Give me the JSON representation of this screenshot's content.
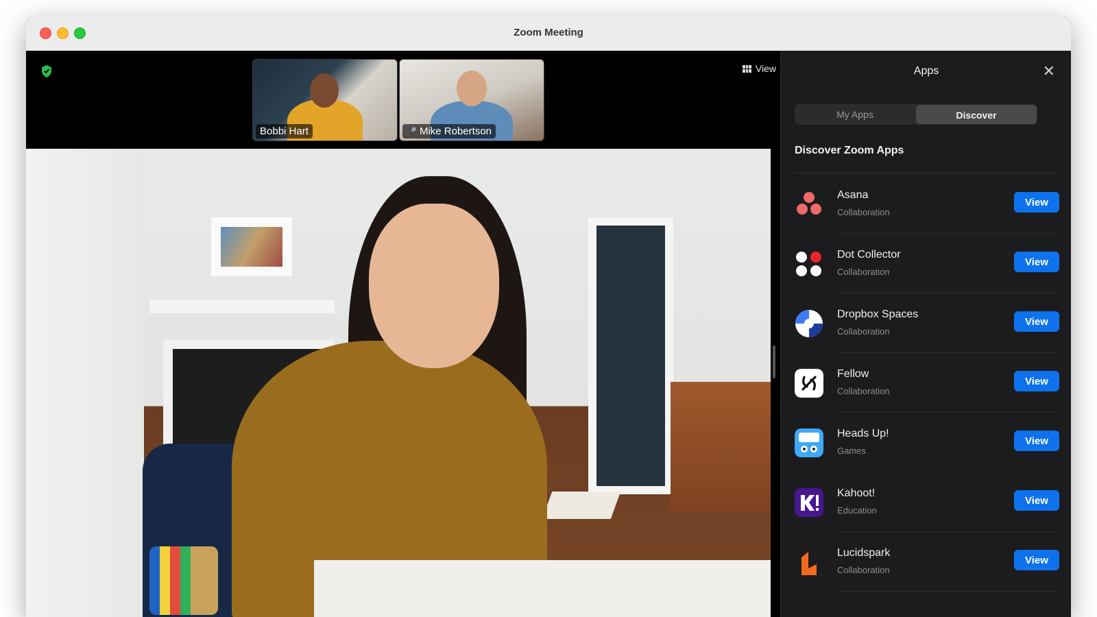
{
  "window": {
    "title": "Zoom Meeting"
  },
  "meeting": {
    "view_label": "View",
    "participants": [
      {
        "name": "Bobbi Hart",
        "muted": false
      },
      {
        "name": "Mike Robertson",
        "muted": true
      }
    ]
  },
  "panel": {
    "title": "Apps",
    "close_icon": "close-icon",
    "tabs": [
      {
        "label": "My Apps",
        "active": false
      },
      {
        "label": "Discover",
        "active": true
      }
    ],
    "section_title": "Discover Zoom Apps",
    "apps": [
      {
        "name": "Asana",
        "category": "Collaboration",
        "button": "View",
        "icon": "asana-icon"
      },
      {
        "name": "Dot Collector",
        "category": "Collaboration",
        "button": "View",
        "icon": "dot-collector-icon"
      },
      {
        "name": "Dropbox Spaces",
        "category": "Collaboration",
        "button": "View",
        "icon": "dropbox-spaces-icon"
      },
      {
        "name": "Fellow",
        "category": "Collaboration",
        "button": "View",
        "icon": "fellow-icon"
      },
      {
        "name": "Heads Up!",
        "category": "Games",
        "button": "View",
        "icon": "heads-up-icon"
      },
      {
        "name": "Kahoot!",
        "category": "Education",
        "button": "View",
        "icon": "kahoot-icon"
      },
      {
        "name": "Lucidspark",
        "category": "Collaboration",
        "button": "View",
        "icon": "lucidspark-icon"
      }
    ]
  },
  "colors": {
    "accent": "#0e72ed",
    "panel_bg": "#1c1c1e",
    "security_green": "#2db84c"
  }
}
